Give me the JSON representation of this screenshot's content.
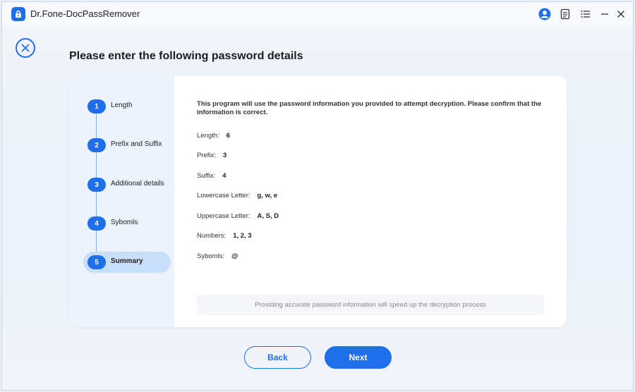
{
  "window": {
    "title": "Dr.Fone-DocPassRemover",
    "accent_color": "#1f6fea"
  },
  "titlebar_icons": [
    "user-avatar-icon",
    "feedback-icon",
    "menu-icon",
    "minimize-icon",
    "close-icon"
  ],
  "page": {
    "title": "Please enter the following password details"
  },
  "steps": [
    {
      "number": "1",
      "label": "Length"
    },
    {
      "number": "2",
      "label": "Prefix and Suffix"
    },
    {
      "number": "3",
      "label": "Additional details"
    },
    {
      "number": "4",
      "label": "Syboml​s"
    },
    {
      "number": "5",
      "label": "Summary",
      "active": true
    }
  ],
  "summary": {
    "intro": "This program will use the password information you provided to attempt decryption. Please confirm that the information is correct.",
    "fields": [
      {
        "label": "Length:",
        "value": "6"
      },
      {
        "label": "Prefix:",
        "value": "3"
      },
      {
        "label": "Suffix:",
        "value": "4"
      },
      {
        "label": "Lowercase Letter:",
        "value": "g, w, e"
      },
      {
        "label": "Uppercase Letter:",
        "value": "A, S, D"
      },
      {
        "label": "Numbers:",
        "value": "1, 2, 3"
      },
      {
        "label": "Sybomls:",
        "value": "@"
      }
    ],
    "hint": "Providing accurate password information will speed up the decryption process"
  },
  "buttons": {
    "back": "Back",
    "next": "Next"
  }
}
